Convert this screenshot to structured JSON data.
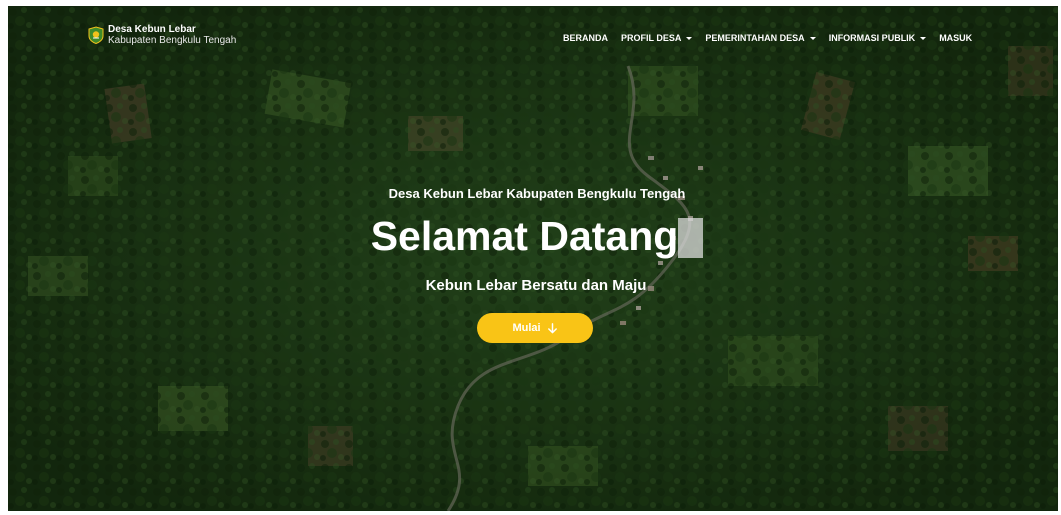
{
  "brand": {
    "name": "Desa Kebun Lebar",
    "subtitle": "Kabupaten Bengkulu Tengah",
    "logo_icon": "village-emblem-icon"
  },
  "nav": {
    "items": [
      {
        "label": "BERANDA",
        "dropdown": false
      },
      {
        "label": "PROFIL DESA",
        "dropdown": true
      },
      {
        "label": "PEMERINTAHAN DESA",
        "dropdown": true
      },
      {
        "label": "INFORMASI PUBLIK",
        "dropdown": true
      },
      {
        "label": "MASUK",
        "dropdown": false
      }
    ]
  },
  "hero": {
    "subheading": "Desa Kebun Lebar Kabupaten Bengkulu Tengah",
    "title": "Selamat Datang",
    "tagline": "Kebun Lebar Bersatu dan Maju",
    "cta_label": "Mulai",
    "cta_icon": "arrow-down-icon"
  },
  "colors": {
    "accent": "#f9c416",
    "text": "#ffffff"
  }
}
